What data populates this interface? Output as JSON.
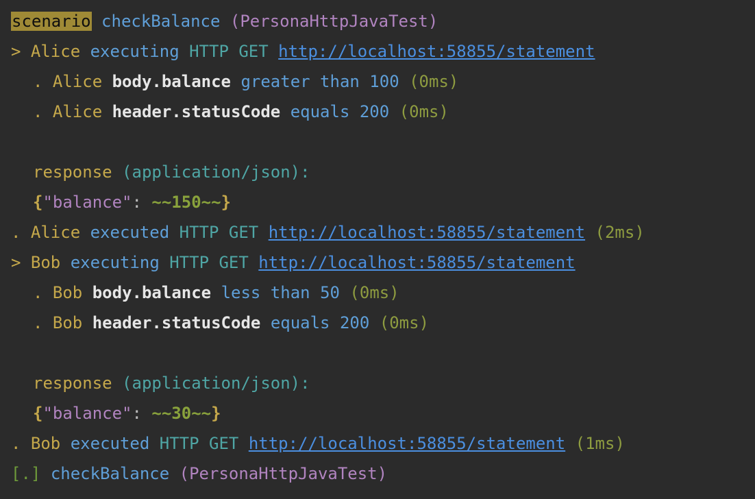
{
  "colors": {
    "background": "#2b2b2b",
    "keyword_highlight": "#9f8a36",
    "persona": "#c5a84b",
    "action": "#5f9fd8",
    "link": "#4b8fe0",
    "test_class": "#b184c0",
    "content_type": "#4fa6a5",
    "timing": "#8e9c40"
  },
  "scenario": {
    "keyword": "scenario",
    "name": "checkBalance",
    "class": "(PersonaHttpJavaTest)"
  },
  "alice": {
    "exec_marker": ">",
    "persona": "Alice",
    "executing": "executing",
    "method": "HTTP GET",
    "url": "http://localhost:58855/statement",
    "check1": {
      "dot": ".",
      "persona": "Alice",
      "path": "body.balance",
      "op": "greater than",
      "value": "100",
      "time": "(0ms)"
    },
    "check2": {
      "dot": ".",
      "persona": "Alice",
      "path": "header.statusCode",
      "op": "equals",
      "value": "200",
      "time": "(0ms)"
    },
    "response_label": "response",
    "response_type": "(application/json):",
    "json_open": "{",
    "json_key": "\"balance\"",
    "json_colon": ":",
    "json_value": "~~150~~",
    "json_close": "}",
    "done_marker": ".",
    "executed": "executed",
    "done_time": "(2ms)"
  },
  "bob": {
    "exec_marker": ">",
    "persona": "Bob",
    "executing": "executing",
    "method": "HTTP GET",
    "url": "http://localhost:58855/statement",
    "check1": {
      "dot": ".",
      "persona": "Bob",
      "path": "body.balance",
      "op": "less than",
      "value": "50",
      "time": "(0ms)"
    },
    "check2": {
      "dot": ".",
      "persona": "Bob",
      "path": "header.statusCode",
      "op": "equals",
      "value": "200",
      "time": "(0ms)"
    },
    "response_label": "response",
    "response_type": "(application/json):",
    "json_open": "{",
    "json_key": "\"balance\"",
    "json_colon": ":",
    "json_value": "~~30~~",
    "json_close": "}",
    "done_marker": ".",
    "executed": "executed",
    "done_time": "(1ms)"
  },
  "summary": {
    "marker": "[.]",
    "name": "checkBalance",
    "class": "(PersonaHttpJavaTest)"
  }
}
